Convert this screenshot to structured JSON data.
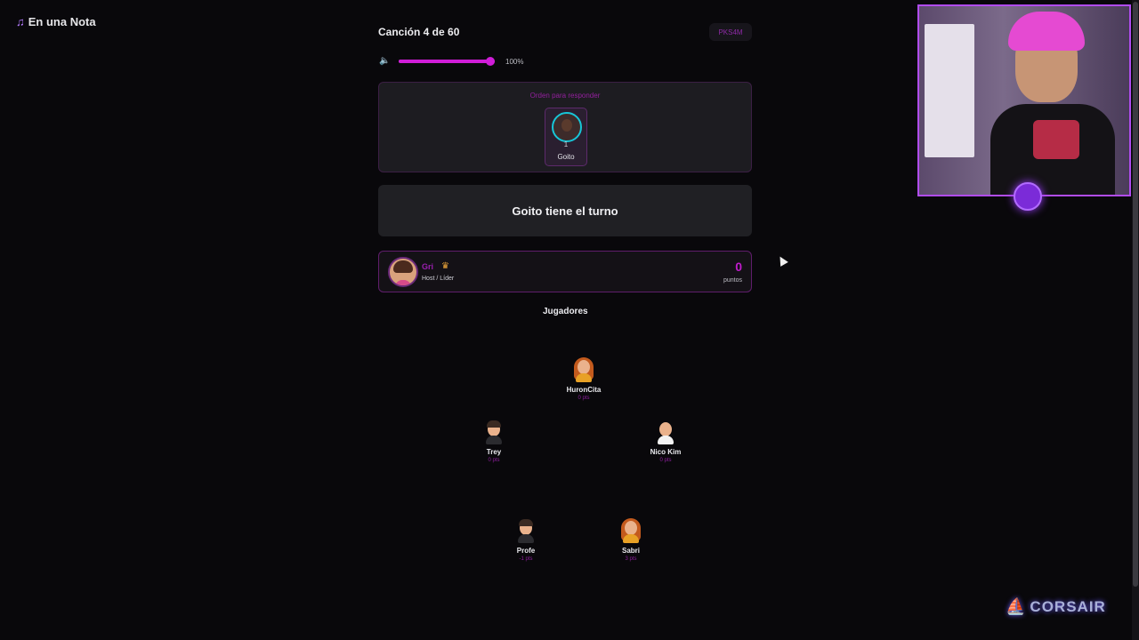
{
  "app": {
    "brand_icon": "music-note-icon",
    "brand_label": "En una Nota"
  },
  "header": {
    "song_counter": "Canción 4 de 60",
    "room_code": "PKS4M"
  },
  "volume": {
    "icon": "speaker-icon",
    "level_percent": 100,
    "label": "100%"
  },
  "answer_order": {
    "label": "Orden para responder",
    "players": [
      {
        "position": "1",
        "name": "Goito"
      }
    ]
  },
  "turn": {
    "message": "Goito tiene el turno"
  },
  "host": {
    "name": "Gri",
    "crown_icon": "crown-icon",
    "role": "Host / Líder",
    "score": "0",
    "score_label": "puntos"
  },
  "players_section": {
    "title": "Jugadores",
    "players": [
      {
        "name": "HuronCita",
        "points": "0 pts"
      },
      {
        "name": "Trey",
        "points": "0 pts"
      },
      {
        "name": "Nico Kim",
        "points": "0 pts"
      },
      {
        "name": "Profe",
        "points": "-1 pts"
      },
      {
        "name": "Sabri",
        "points": "3 pts"
      }
    ]
  },
  "overlay": {
    "sponsor": "CORSAIR"
  },
  "colors": {
    "accent": "#c01ccc",
    "background": "#09080b",
    "card": "#1d1c21",
    "turquoise": "#17c6d7"
  }
}
